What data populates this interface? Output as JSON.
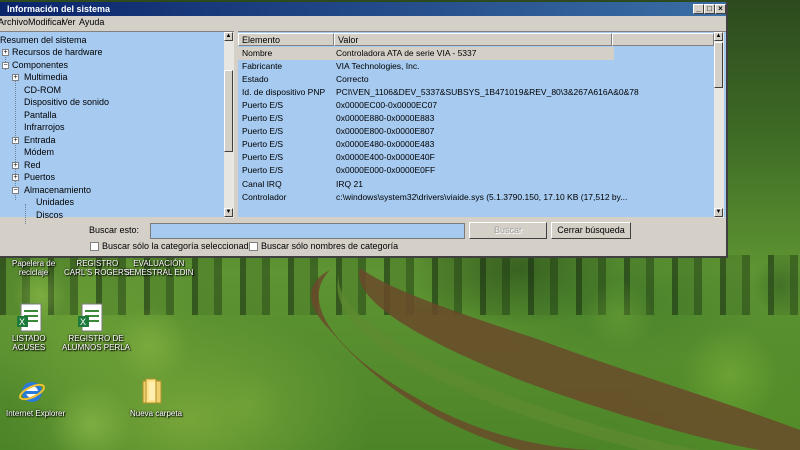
{
  "window": {
    "title": "Información del sistema",
    "menu": [
      "Archivo",
      "Modificar",
      "Ver",
      "Ayuda"
    ],
    "controls": {
      "minimize": "_",
      "maximize": "□",
      "close": "×"
    }
  },
  "tree": {
    "items": [
      {
        "label": "Resumen del sistema",
        "expander": ""
      },
      {
        "label": "Recursos de hardware",
        "expander": "+"
      },
      {
        "label": "Componentes",
        "expander": "−"
      },
      {
        "label": "Multimedia",
        "expander": "+"
      },
      {
        "label": "CD-ROM",
        "expander": ""
      },
      {
        "label": "Dispositivo de sonido",
        "expander": ""
      },
      {
        "label": "Pantalla",
        "expander": ""
      },
      {
        "label": "Infrarrojos",
        "expander": ""
      },
      {
        "label": "Entrada",
        "expander": "+"
      },
      {
        "label": "Módem",
        "expander": ""
      },
      {
        "label": "Red",
        "expander": "+"
      },
      {
        "label": "Puertos",
        "expander": "+"
      },
      {
        "label": "Almacenamiento",
        "expander": "−"
      },
      {
        "label": "Unidades",
        "expander": ""
      },
      {
        "label": "Discos",
        "expander": ""
      }
    ]
  },
  "details": {
    "columns": [
      "Elemento",
      "Valor"
    ],
    "rows": [
      {
        "item": "Nombre",
        "value": "Controladora ATA de serie VIA - 5337"
      },
      {
        "item": "Fabricante",
        "value": "VIA Technologies, Inc."
      },
      {
        "item": "Estado",
        "value": "Correcto"
      },
      {
        "item": "Id. de dispositivo PNP",
        "value": "PCI\\VEN_1106&DEV_5337&SUBSYS_1B471019&REV_80\\3&267A616A&0&78"
      },
      {
        "item": "Puerto E/S",
        "value": "0x0000EC00-0x0000EC07"
      },
      {
        "item": "Puerto E/S",
        "value": "0x0000E880-0x0000E883"
      },
      {
        "item": "Puerto E/S",
        "value": "0x0000E800-0x0000E807"
      },
      {
        "item": "Puerto E/S",
        "value": "0x0000E480-0x0000E483"
      },
      {
        "item": "Puerto E/S",
        "value": "0x0000E400-0x0000E40F"
      },
      {
        "item": "Puerto E/S",
        "value": "0x0000E000-0x0000E0FF"
      },
      {
        "item": "Canal IRQ",
        "value": "IRQ 21"
      },
      {
        "item": "Controlador",
        "value": "c:\\windows\\system32\\drivers\\viaide.sys (5.1.3790.150, 17.10 KB (17,512 by..."
      }
    ]
  },
  "search": {
    "label": "Buscar esto:",
    "value": "",
    "find_button": "Buscar",
    "close_button": "Cerrar búsqueda",
    "option_selected_category": "Buscar sólo la categoría seleccionada",
    "option_category_names": "Buscar sólo nombres de categoría"
  },
  "desktop": {
    "icons": [
      {
        "label1": "Papelera de",
        "label2": "reciclaje"
      },
      {
        "label1": "REGISTRO",
        "label2": "CARL'S ROGER'S"
      },
      {
        "label1": "EVALUACIÓN",
        "label2": "SEMESTRAL EDIN"
      },
      {
        "label1": "LISTADO",
        "label2": "ACUSES"
      },
      {
        "label1": "REGISTRO DE",
        "label2": "ALUMNOS PERLA"
      },
      {
        "label1": "Internet Explorer",
        "label2": ""
      },
      {
        "label1": "Nueva carpeta",
        "label2": ""
      }
    ]
  }
}
